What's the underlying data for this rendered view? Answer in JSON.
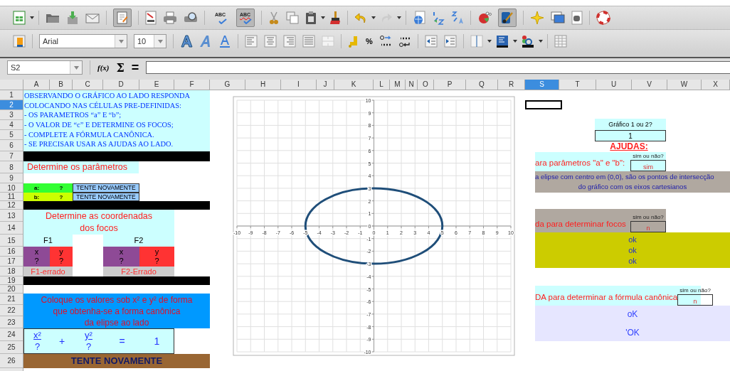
{
  "toolbar": {
    "spell_labels": [
      "ABC",
      "ABC"
    ],
    "autospell_on": true,
    "edit_on": true,
    "draw_on": true
  },
  "format_bar": {
    "font_name": "Arial",
    "font_size": "10",
    "percent": "%"
  },
  "formula_bar": {
    "cell_ref": "S2",
    "function_wizard": "f(x)",
    "sum": "Σ",
    "equals": "="
  },
  "sheet": {
    "columns": [
      {
        "label": "A",
        "selected": false
      },
      {
        "label": "B",
        "selected": false
      },
      {
        "label": "C",
        "selected": false
      },
      {
        "label": "D",
        "selected": false
      },
      {
        "label": "E",
        "selected": false
      },
      {
        "label": "F",
        "selected": false
      },
      {
        "label": "G",
        "selected": false
      },
      {
        "label": "H",
        "selected": false
      },
      {
        "label": "I",
        "selected": false
      },
      {
        "label": "J",
        "selected": false
      },
      {
        "label": "K",
        "selected": false
      },
      {
        "label": "L",
        "selected": false
      },
      {
        "label": "M",
        "selected": false
      },
      {
        "label": "N",
        "selected": false
      },
      {
        "label": "O",
        "selected": false
      },
      {
        "label": "P",
        "selected": false
      },
      {
        "label": "Q",
        "selected": false
      },
      {
        "label": "R",
        "selected": false
      },
      {
        "label": "S",
        "selected": true
      },
      {
        "label": "T",
        "selected": false
      },
      {
        "label": "U",
        "selected": false
      },
      {
        "label": "V",
        "selected": false
      },
      {
        "label": "W",
        "selected": false
      },
      {
        "label": "X",
        "selected": false
      }
    ],
    "rows": [
      {
        "label": "1",
        "selected": false
      },
      {
        "label": "2",
        "selected": true
      },
      {
        "label": "3",
        "selected": false
      },
      {
        "label": "4",
        "selected": false
      },
      {
        "label": "5",
        "selected": false
      },
      {
        "label": "6",
        "selected": false
      },
      {
        "label": "7",
        "selected": false
      },
      {
        "label": "8",
        "selected": false
      },
      {
        "label": "9",
        "selected": false
      },
      {
        "label": "10",
        "selected": false
      },
      {
        "label": "11",
        "selected": false
      },
      {
        "label": "12",
        "selected": false
      },
      {
        "label": "13",
        "selected": false
      },
      {
        "label": "14",
        "selected": false
      },
      {
        "label": "15",
        "selected": false
      },
      {
        "label": "16",
        "selected": false
      },
      {
        "label": "17",
        "selected": false
      },
      {
        "label": "18",
        "selected": false
      },
      {
        "label": "19",
        "selected": false
      },
      {
        "label": "20",
        "selected": false
      },
      {
        "label": "21",
        "selected": false
      },
      {
        "label": "22",
        "selected": false
      },
      {
        "label": "23",
        "selected": false
      },
      {
        "label": "24",
        "selected": false
      },
      {
        "label": "25",
        "selected": false
      },
      {
        "label": "26",
        "selected": false
      }
    ],
    "instructions": [
      "OBSERVANDO O GRÁFICO AO LADO RESPONDA",
      "COLOCANDO NAS CÉLULAS PRE-DEFINIDAS:",
      "- OS PARAMETROS “a” E “b”;",
      "- O VALOR DE “c” E DETERMINE OS FOCOS;",
      "- COMPLETE A FÓRMULA CANÔNICA.",
      "- SE PRECISAR USAR AS AJUDAS AO LADO."
    ],
    "params_title": "Determine os parâmetros",
    "params": [
      {
        "name": "a:",
        "value": "?",
        "status": "TENTE NOVAMENTE",
        "color": "#33ff33"
      },
      {
        "name": "b:",
        "value": "?",
        "status": "TENTE NOVAMENTE",
        "color": "#ccff00"
      }
    ],
    "foci_title": [
      "Determine as coordenadas",
      "dos focos"
    ],
    "foci": [
      {
        "label": "F1",
        "x_header": "x",
        "y_header": "y",
        "x": "?",
        "y": "?",
        "status": "F1-errado"
      },
      {
        "label": "F2",
        "x_header": "x",
        "y_header": "y",
        "x": "?",
        "y": "?",
        "status": "F2-Errado"
      }
    ],
    "formula_prompt": [
      "Coloque os valores sob x² e y² de forma",
      "que obtenha-se a forma canônica",
      "da elipse ao lado"
    ],
    "formula": {
      "x_num": "x²",
      "x_den": "?",
      "plus": "+",
      "y_num": "y²",
      "y_den": "?",
      "equals": "=",
      "rhs": "1"
    },
    "result": "TENTE NOVAMENTE"
  },
  "chart": {
    "chart_data": {
      "type": "line",
      "xlim": [
        -10,
        10
      ],
      "ylim": [
        -10,
        10
      ],
      "xticks": [
        -10,
        -9,
        -8,
        -7,
        -6,
        -5,
        -4,
        -3,
        -2,
        -1,
        0,
        1,
        2,
        3,
        4,
        5,
        6,
        7,
        8,
        9,
        10
      ],
      "yticks": [
        -10,
        -9,
        -8,
        -7,
        -6,
        -5,
        -4,
        -3,
        -2,
        -1,
        0,
        1,
        2,
        3,
        4,
        5,
        6,
        7,
        8,
        9,
        10
      ],
      "grid": true
    }
  },
  "helpers": {
    "graph_question": "Gráfico 1 ou 2?",
    "graph_choice": "1",
    "title": "AJUDAS:",
    "sections": [
      {
        "kind": "parameters",
        "prompt": "ara parâmetros \"a\" e \"b\":",
        "question": "sim ou não?",
        "answer": "sim",
        "lines": [
          "a elipse com centro em (0,0), são os pontos de intersecção",
          "do gráfico com os eixos cartesianos"
        ]
      },
      {
        "kind": "foci",
        "prompt": "da para determinar focos",
        "question": "sim ou não?",
        "answer": "n",
        "lines": [
          "ok",
          "ok",
          "ok"
        ]
      },
      {
        "kind": "formula",
        "prompt": "DA para determinar a fórmula canônica",
        "question": "sim ou não?",
        "answer": "n",
        "lines": [
          "oK",
          "'OK"
        ]
      }
    ]
  }
}
